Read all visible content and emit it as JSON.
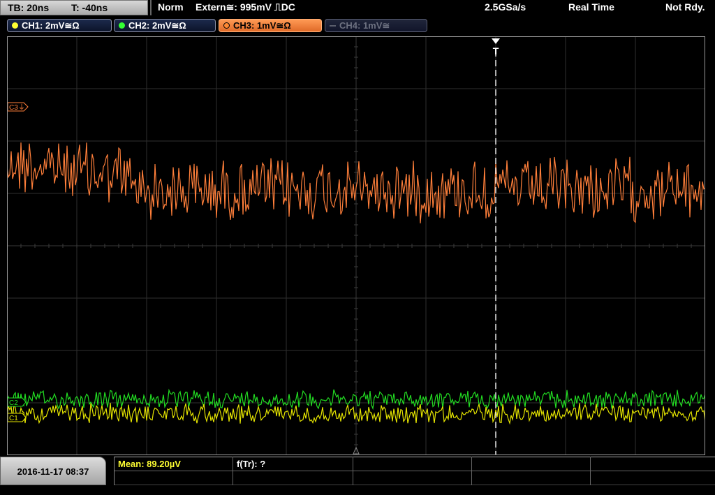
{
  "status_bar": {
    "timebase": "TB: 20ns",
    "trigger_offset": "T: -40ns",
    "trigger_mode": "Norm",
    "trigger_source": "Extern≅: 995mV ⎍DC",
    "sample_rate": "2.5GSa/s",
    "acq_mode": "Real Time",
    "run_state": "Not Rdy."
  },
  "channels": [
    {
      "label": "CH1: 2mV≅Ω",
      "color": "#ffff33",
      "state": "on"
    },
    {
      "label": "CH2: 2mV≅Ω",
      "color": "#33ff33",
      "state": "on"
    },
    {
      "label": "CH3: 1mV≅Ω",
      "color": "#ff8833",
      "state": "active"
    },
    {
      "label": "CH4: 1mV≅",
      "color": "#5a5e6c",
      "state": "off"
    }
  ],
  "markers": {
    "c3": "C3",
    "c2": "C2",
    "c1": "C1",
    "trigger": "T"
  },
  "colors": {
    "ch1": "#e6e600",
    "ch2": "#22dd22",
    "ch3": "#ff7f3a",
    "grid": "#2f2f2f",
    "frame": "#9a9a9a"
  },
  "bottom_bar": {
    "datetime": "2016-11-17 08:37",
    "meas1": "Mean: 89.20µV",
    "meas2": "f(Tr): ?"
  }
}
